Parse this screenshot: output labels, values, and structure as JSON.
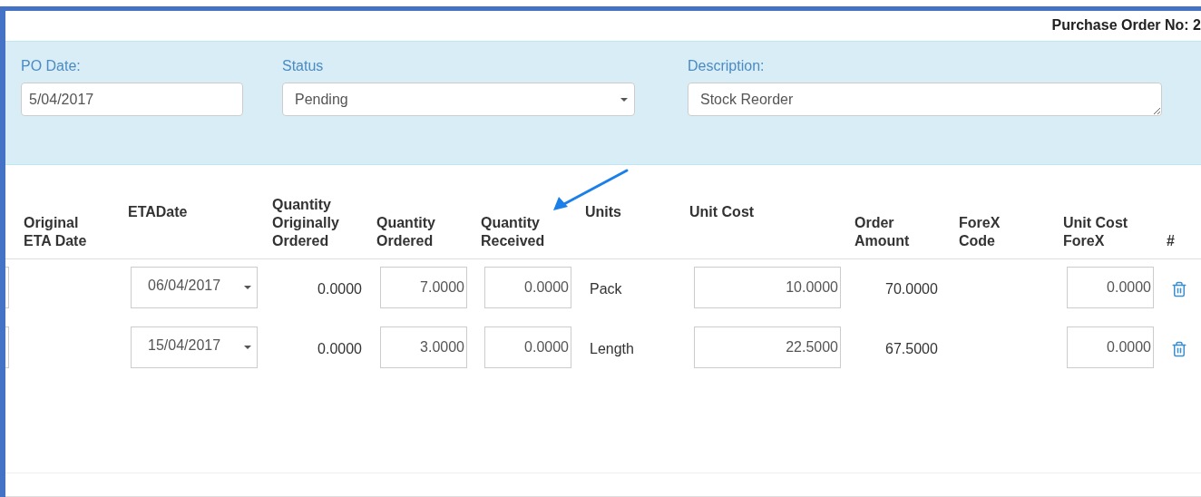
{
  "header": {
    "title": "Purchase Order No: 2"
  },
  "form": {
    "po_date": {
      "label": "PO Date:",
      "value": "5/04/2017"
    },
    "status": {
      "label": "Status",
      "value": "Pending"
    },
    "description": {
      "label": "Description:",
      "value": "Stock Reorder"
    }
  },
  "table": {
    "columns": [
      "Original\nETA Date",
      "ETADate",
      "Quantity\nOriginally\nOrdered",
      "Quantity\nOrdered",
      "Quantity\nReceived",
      "Units",
      "Unit Cost",
      "Order\nAmount",
      "ForeX\nCode",
      "Unit Cost\nForeX",
      "#"
    ],
    "rows": [
      {
        "eta_date": "06/04/2017",
        "qty_originally_ordered": "0.0000",
        "qty_ordered": "7.0000",
        "qty_received": "0.0000",
        "units": "Pack",
        "unit_cost": "10.0000",
        "order_amount": "70.0000",
        "unit_cost_forex": "0.0000"
      },
      {
        "eta_date": "15/04/2017",
        "qty_originally_ordered": "0.0000",
        "qty_ordered": "3.0000",
        "qty_received": "0.0000",
        "units": "Length",
        "unit_cost": "22.5000",
        "order_amount": "67.5000",
        "unit_cost_forex": "0.0000"
      }
    ]
  }
}
